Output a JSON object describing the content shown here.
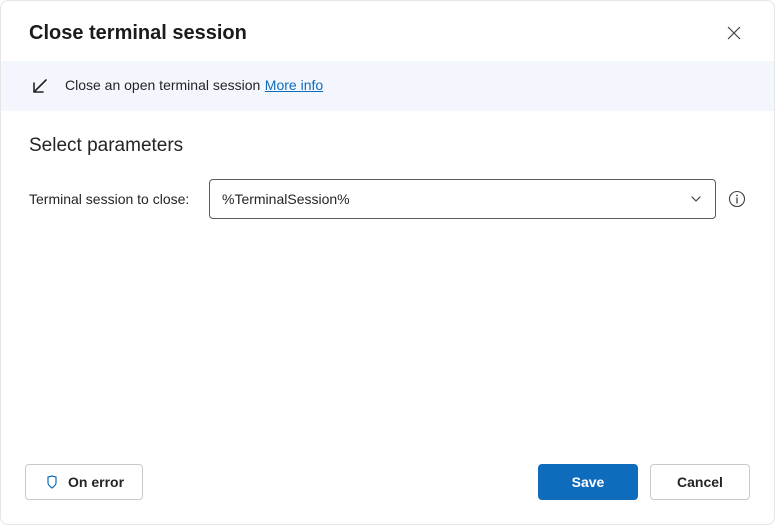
{
  "header": {
    "title": "Close terminal session"
  },
  "banner": {
    "description": "Close an open terminal session",
    "link_label": "More info"
  },
  "content": {
    "section_title": "Select parameters",
    "field_label": "Terminal session to close:",
    "field_value": "%TerminalSession%"
  },
  "footer": {
    "on_error_label": "On error",
    "save_label": "Save",
    "cancel_label": "Cancel"
  }
}
